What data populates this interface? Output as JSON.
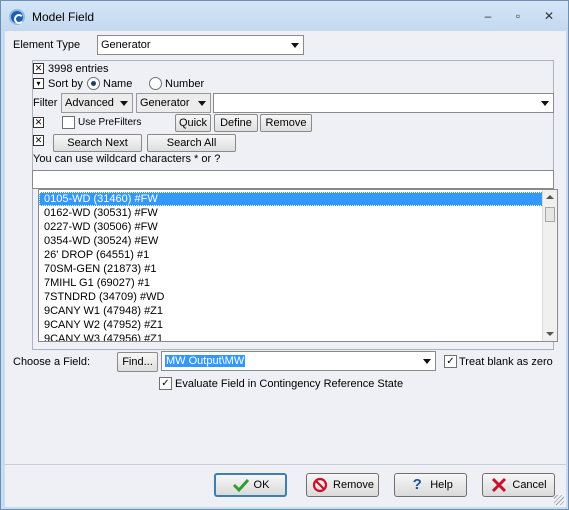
{
  "window": {
    "title": "Model Field",
    "buttons": [
      "–",
      "▫",
      "✕"
    ]
  },
  "element_type": {
    "label": "Element Type",
    "value": "Generator"
  },
  "filter_panel": {
    "entries_text": "3998 entries",
    "sort_by_label": "Sort by",
    "sort_options": [
      "Name",
      "Number"
    ],
    "sort_selected": "Name",
    "filter_label": "Filter",
    "filter_mode": "Advanced",
    "filter_object": "Generator",
    "filter_text": "",
    "use_prefilters_label": "Use PreFilters",
    "quick_label": "Quick",
    "define_label": "Define",
    "remove_label": "Remove",
    "search_next_label": "Search Next",
    "search_all_label": "Search All",
    "wildcard_hint": "You can use wildcard characters * or ?",
    "search_value": ""
  },
  "list": {
    "items": [
      "0105-WD (31460) #FW",
      "0162-WD (30531) #FW",
      "0227-WD (30506) #FW",
      "0354-WD (30524) #EW",
      "26' DROP (64551) #1",
      "70SM-GEN (21873) #1",
      "7MIHL G1 (69027) #1",
      "7STNDRD (34709) #WD",
      "9CANY W1 (47948) #Z1",
      "9CANY W2 (47952) #Z1",
      "9CANY W3 (47956) #Z1"
    ],
    "selected_index": 0
  },
  "field": {
    "label": "Choose a Field:",
    "find_label": "Find...",
    "value": "MW Output\\MW",
    "treat_blank_label": "Treat blank as zero",
    "treat_blank_checked": true,
    "evaluate_label": "Evaluate Field in Contingency Reference State",
    "evaluate_checked": true
  },
  "actions": {
    "ok": "OK",
    "remove": "Remove",
    "help": "Help",
    "cancel": "Cancel"
  },
  "colors": {
    "selection": "#3399ff",
    "ok_icon": "#2e9e2e",
    "remove_icon": "#c8102e",
    "cancel_icon": "#c8102e",
    "help_icon": "#1f4e9c"
  }
}
